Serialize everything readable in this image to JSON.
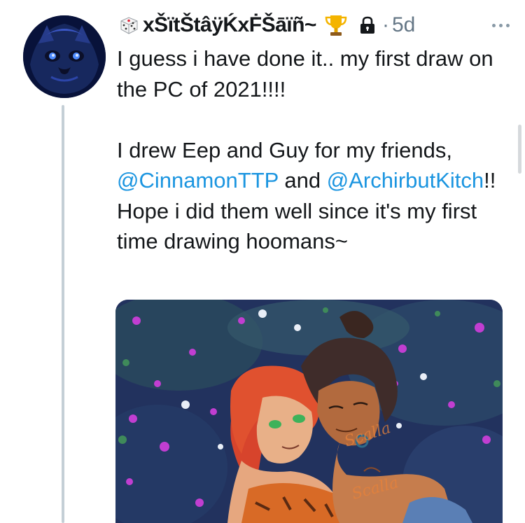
{
  "tweet": {
    "author": {
      "display_name": "xŠïtŠtâÿḰxḞŠāïñ~",
      "badge_left": "dice-icon",
      "badge_right": "trophy-icon",
      "protected": "lock-icon"
    },
    "separator": "·",
    "timestamp": "5d",
    "more_icon": "more-icon",
    "text": {
      "line1": "I guess i have done it.. my first draw on the PC of 2021!!!!",
      "line2_prefix": "I drew Eep and Guy for my friends, ",
      "mention1": "@CinnamonTTP",
      "line2_mid": " and ",
      "mention2": "@ArchirbutKitch",
      "line2_suffix": "!! Hope i did them well since it's my first time drawing hoomans~"
    },
    "media": {
      "watermark_1": "Scalla",
      "watermark_2": "Scalla"
    }
  },
  "colors": {
    "text": "#14171a",
    "muted": "#657786",
    "mention": "#1b95e0",
    "thread_line": "#c4cfd6"
  }
}
